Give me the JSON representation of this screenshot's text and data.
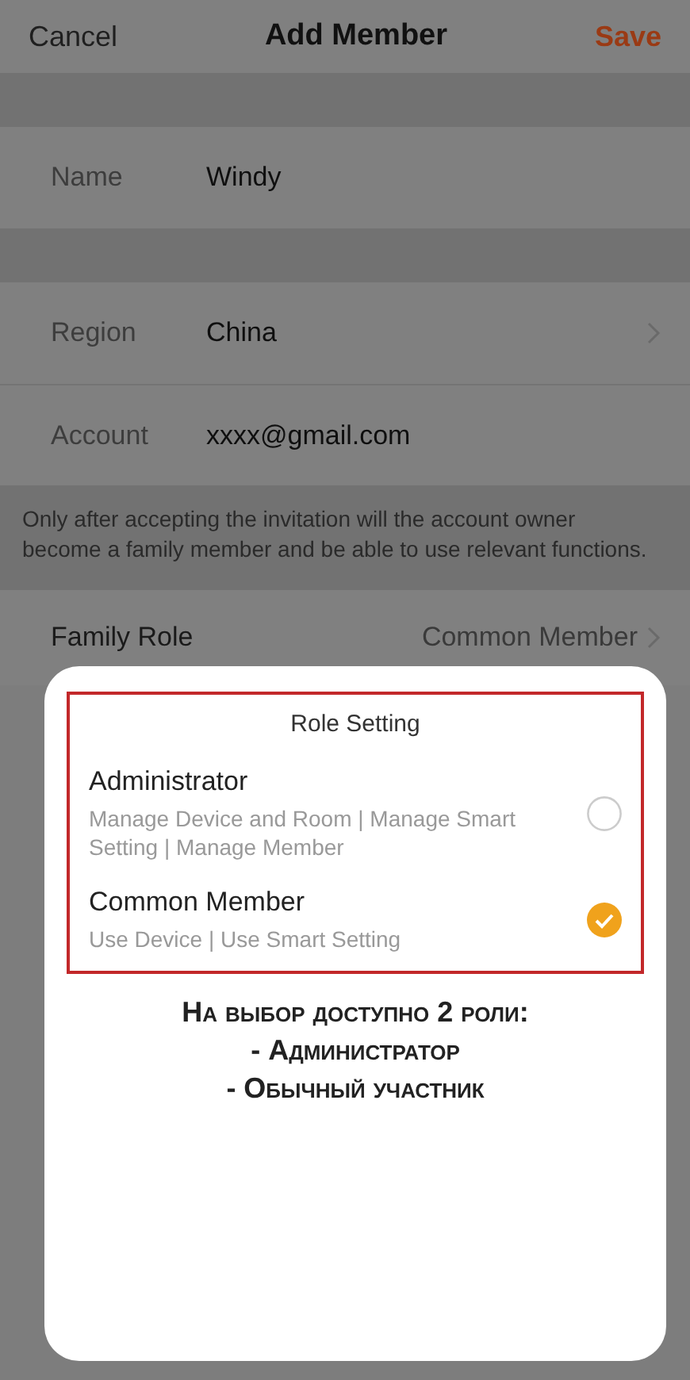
{
  "header": {
    "cancel": "Cancel",
    "title": "Add Member",
    "save": "Save"
  },
  "fields": [
    {
      "label": "Name",
      "value": "Windy",
      "chevron": false,
      "gap_before": true
    },
    {
      "label": "Region",
      "value": "China",
      "chevron": true,
      "gap_before": true
    },
    {
      "label": "Account",
      "value": "xxxx@gmail.com",
      "chevron": false,
      "gap_before": false
    }
  ],
  "note": "Only after accepting the invitation will the account owner become a family member and be able to use relevant functions.",
  "family_role": {
    "label": "Family Role",
    "value": "Common Member"
  },
  "role_sheet": {
    "title": "Role Setting",
    "roles": [
      {
        "name": "Administrator",
        "description": "Manage Device and Room | Manage Smart Setting | Manage Member",
        "selected": false
      },
      {
        "name": "Common Member",
        "description": "Use Device | Use Smart Setting",
        "selected": true
      }
    ]
  },
  "annotation": [
    "На выбор доступно 2 роли:",
    "- Администратор",
    "- Обычный участник"
  ]
}
